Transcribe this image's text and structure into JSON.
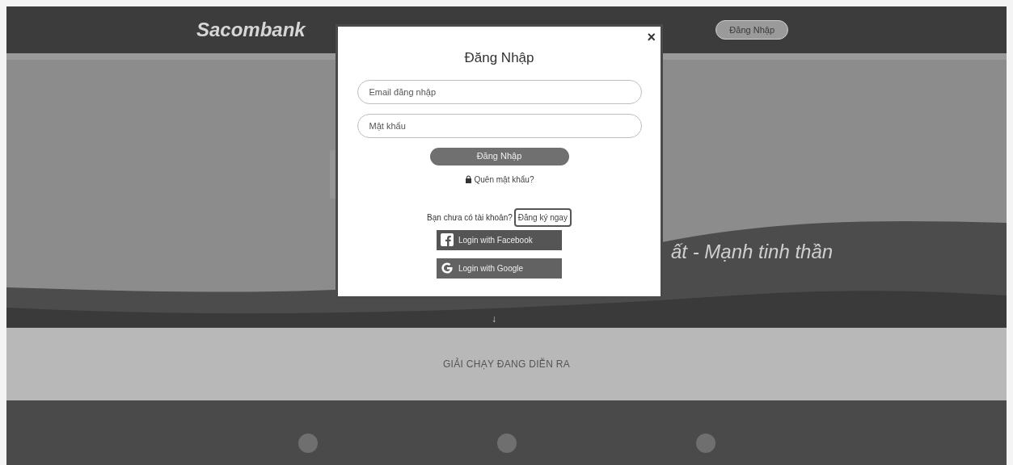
{
  "header": {
    "logo": "Sacombank",
    "login_button": "Đăng Nhập"
  },
  "banner": {
    "kind": "picture",
    "caption": "ất - Mạnh tinh thần"
  },
  "scroll_hint": "↓",
  "section": {
    "title": "GIẢI CHẠY ĐANG DIỄN RA"
  },
  "login_dialog": {
    "close": "×",
    "title": "Đăng Nhập",
    "fields": [
      {
        "placeholder": "Email đăng nhập"
      },
      {
        "placeholder": "Mật khẩu"
      }
    ],
    "submit": "Đăng Nhập",
    "forgot": "Quên mật khẩu?",
    "signup_prompt": "Bạn chưa có tài khoản?",
    "signup_link": "Đăng ký ngay",
    "social": [
      {
        "kind": "facebook",
        "label": "Login with Facebook"
      },
      {
        "kind": "google",
        "label": "Login with Google"
      }
    ]
  }
}
